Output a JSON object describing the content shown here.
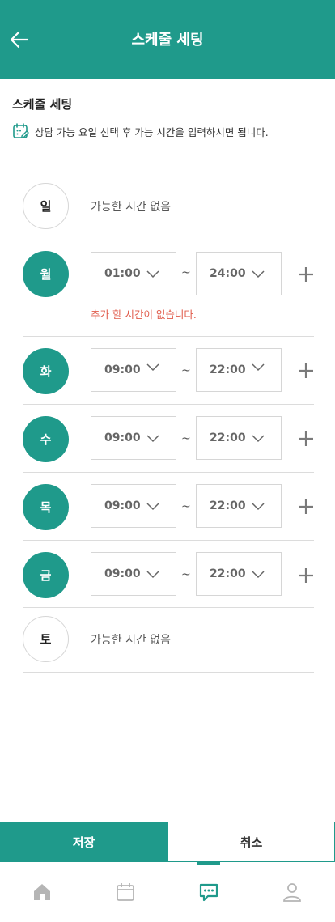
{
  "header": {
    "title": "스케줄 세팅",
    "back_icon": "arrow-left-icon"
  },
  "section": {
    "title": "스케줄 세팅",
    "description": "상담 가능 요일 선택 후 가능 시간을 입력하시면 됩니다."
  },
  "days": [
    {
      "label": "일",
      "available": false,
      "no_time_text": "가능한 시간 없음"
    },
    {
      "label": "월",
      "available": true,
      "start": "01:00",
      "end": "24:00",
      "error": "추가 할 시간이 없습니다."
    },
    {
      "label": "화",
      "available": true,
      "start": "09:00",
      "end": "22:00"
    },
    {
      "label": "수",
      "available": true,
      "start": "09:00",
      "end": "22:00"
    },
    {
      "label": "목",
      "available": true,
      "start": "09:00",
      "end": "22:00"
    },
    {
      "label": "금",
      "available": true,
      "start": "09:00",
      "end": "22:00"
    },
    {
      "label": "토",
      "available": false,
      "no_time_text": "가능한 시간 없음"
    }
  ],
  "separator": "~",
  "buttons": {
    "save": "저장",
    "cancel": "취소"
  },
  "nav": [
    {
      "icon": "home-icon",
      "active": false
    },
    {
      "icon": "calendar-icon",
      "active": false
    },
    {
      "icon": "chat-icon",
      "active": true
    },
    {
      "icon": "profile-icon",
      "active": false
    }
  ],
  "colors": {
    "accent": "#1f9a8b",
    "error": "#e05a4a"
  }
}
